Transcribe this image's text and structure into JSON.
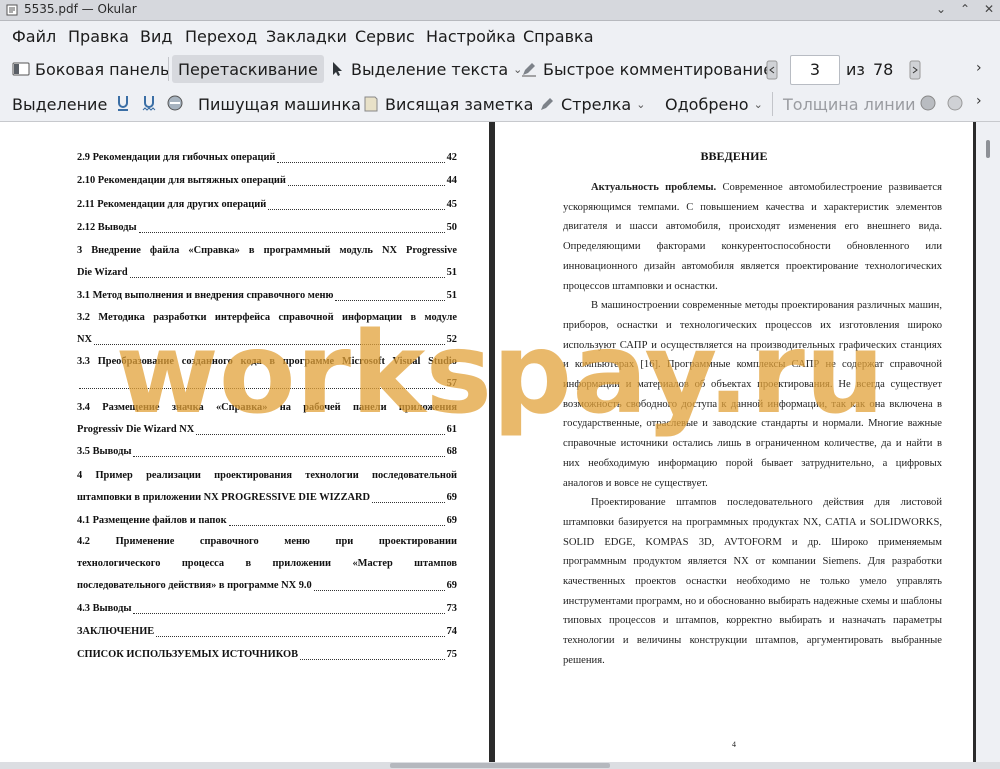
{
  "window": {
    "title": "5535.pdf — Okular"
  },
  "menubar": [
    "Файл",
    "Правка",
    "Вид",
    "Переход",
    "Закладки",
    "Сервис",
    "Настройка",
    "Справка"
  ],
  "toolbar1": {
    "sidebar": "Боковая панель",
    "drag": "Перетаскивание",
    "text_select": "Выделение текста",
    "quick_comment": "Быстрое комментирование",
    "page_current": "3",
    "of_label": "из",
    "page_total": "78"
  },
  "toolbar2": {
    "highlight": "Выделение",
    "typewriter": "Пишущая машинка",
    "sticky_note": "Висящая заметка",
    "arrow": "Стрелка",
    "approved": "Одобрено",
    "line_width": "Толщина линии"
  },
  "left_page": {
    "toc": [
      {
        "text": "2.9 Рекомендации для гибочных операций",
        "page": "42"
      },
      {
        "text": "2.10 Рекомендации для вытяжных операций",
        "page": "44"
      },
      {
        "text": "2.11 Рекомендации для других операций",
        "page": "45"
      },
      {
        "text": "2.12 Выводы",
        "page": "50"
      },
      {
        "line1": "3 Внедрение файла «Справка» в программный модуль NX Progressive",
        "text": "Die Wizard",
        "page": "51"
      },
      {
        "text": "3.1 Метод выполнения и внедрения справочного меню",
        "page": "51"
      },
      {
        "line1": "3.2 Методика разработки интерфейса справочной информации в модуле",
        "text": "NX",
        "page": "52"
      },
      {
        "line1": "3.3 Преобразование созданного кода в программе Microsoft Visual Studio",
        "text": "",
        "page": "57"
      },
      {
        "line1": "3.4 Размещение значка «Справка» на рабочей панели приложения",
        "text": "Progressiv Die Wizard NX",
        "page": "61"
      },
      {
        "text": "3.5 Выводы",
        "page": "68"
      },
      {
        "line1": "4 Пример реализации проектирования технологии последовательной",
        "text": "штамповки в приложении NX PROGRESSIVE DIE WIZZARD",
        "page": "69"
      },
      {
        "text": "4.1 Размещение файлов и папок",
        "page": "69"
      },
      {
        "line1": "4.2 Применение справочного меню при проектировании",
        "line2": "технологического процесса в приложении «Мастер штампов",
        "text": "последовательного действия» в программе NX 9.0",
        "page": "69"
      },
      {
        "text": "4.3 Выводы",
        "page": "73"
      },
      {
        "text": "ЗАКЛЮЧЕНИЕ",
        "page": "74"
      },
      {
        "text": "СПИСОК ИСПОЛЬЗУЕМЫХ ИСТОЧНИКОВ",
        "page": "75"
      }
    ]
  },
  "right_page": {
    "heading": "ВВЕДЕНИЕ",
    "p1_bold": "Актуальность проблемы.",
    "p1": " Современное автомобилестроение развивается ускоряющимся темпами. С повышением качества и характеристик элементов двигателя и шасси автомобиля, происходят изменения его внешнего вида. Определяющими факторами конкурентоспособности обновленного или инновационного дизайн автомобиля является проектирование технологических процессов штамповки и оснастки.",
    "p2": "В машиностроении современные методы проектирования различных машин, приборов, оснастки и технологических процессов их изготовления широко используют САПР и осуществляется на производительных графических станциях и компьютерах [16]. Программные комплексы САПР не содержат справочной информации и материалов об объектах проектирования. Не всегда существует возможность свободного доступа к данной информации, так как она включена в государственные, отраслевые и заводские стандарты и нормали. Многие важные справочные источники остались лишь в ограниченном количестве, да и найти в них необходимую информацию порой бывает затруднительно, а цифровых аналогов и вовсе не существует.",
    "p3": "Проектирование штампов последовательного действия для листовой штамповки базируется на программных продуктах NX, CATIA и SOLIDWORKS, SOLID EDGE, KOMPAS 3D, AVTOFORM и др. Широко применяемым программным продуктом является NX от компании Siemens. Для разработки качественных проектов оснастки необходимо не только умело управлять инструментами программ, но и обоснованно выбирать надежные схемы и шаблоны типовых процессов и штампов, корректно выбирать и назначать параметры технологии и величины конструкции штампов, аргументировать выбранные решения.",
    "page_number": "4"
  },
  "watermark": "workspay.ru",
  "colors": {
    "watermark": "#e1a23a",
    "accent": "#d7d9de"
  }
}
